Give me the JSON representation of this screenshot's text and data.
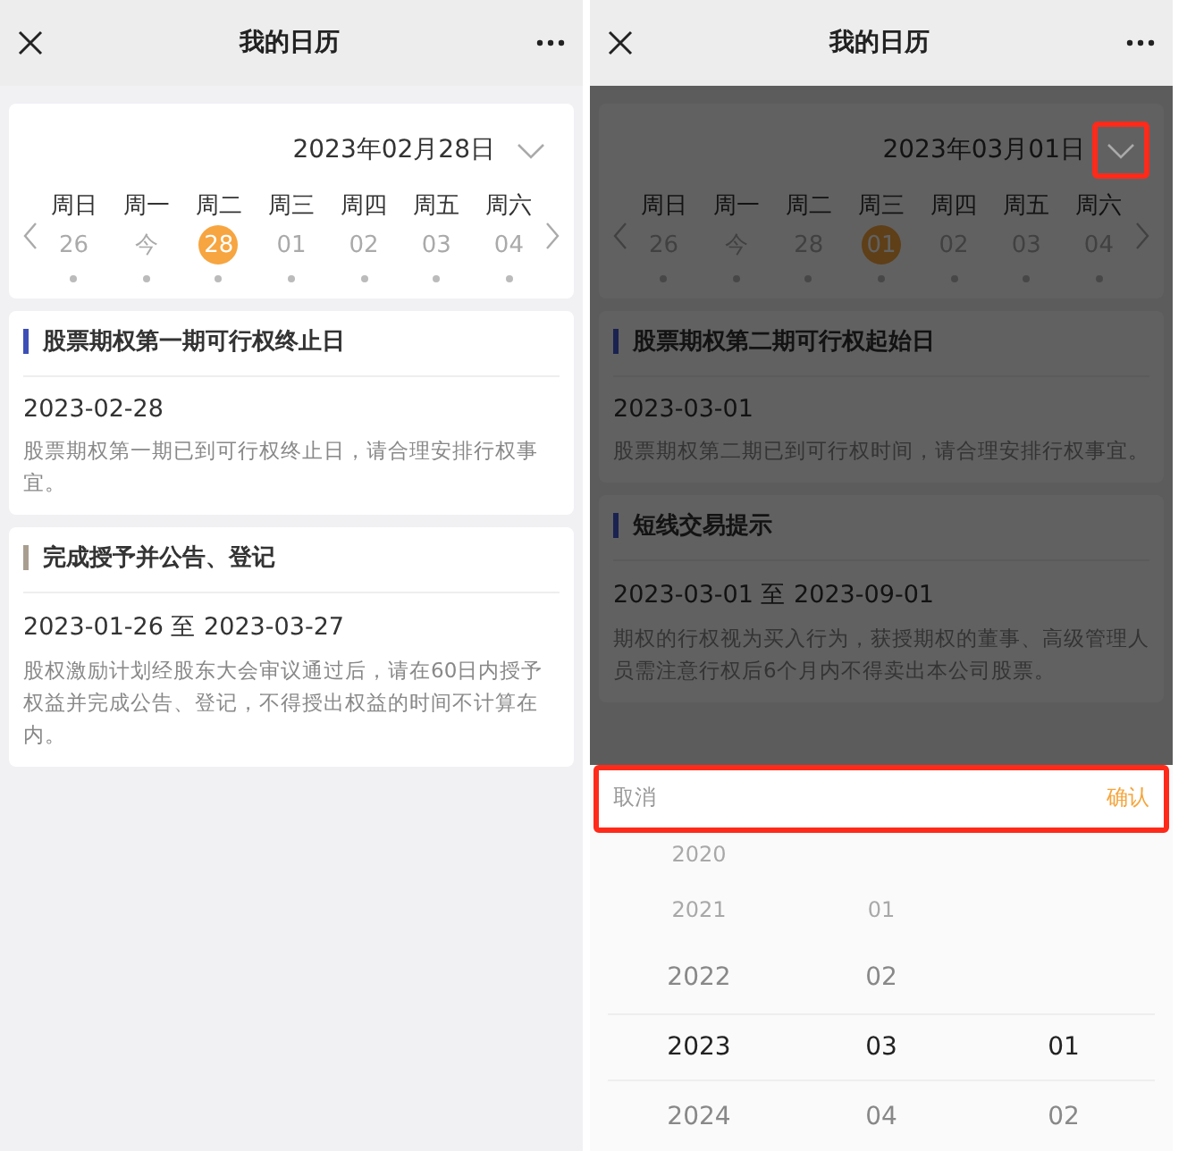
{
  "screens": [
    {
      "title": "我的日历",
      "date": "2023年02月28日",
      "date_highlighted": false,
      "dimmed": false,
      "weekdays": [
        "周日",
        "周一",
        "周二",
        "周三",
        "周四",
        "周五",
        "周六"
      ],
      "days": [
        {
          "label": "26",
          "selected": false
        },
        {
          "label": "今",
          "selected": false
        },
        {
          "label": "28",
          "selected": true
        },
        {
          "label": "01",
          "selected": false
        },
        {
          "label": "02",
          "selected": false
        },
        {
          "label": "03",
          "selected": false
        },
        {
          "label": "04",
          "selected": false
        }
      ],
      "events": [
        {
          "title": "股票期权第一期可行权终止日",
          "color": "#3d4fb5",
          "dates": "2023-02-28",
          "desc": "股票期权第一期已到可行权终止日，请合理安排行权事宜。"
        },
        {
          "title": "完成授予并公告、登记",
          "color": "#a89e90",
          "dates": "2023-01-26 至 2023-03-27",
          "desc": "股权激励计划经股东大会审议通过后，请在60日内授予权益并完成公告、登记，不得授出权益的时间不计算在内。"
        }
      ]
    },
    {
      "title": "我的日历",
      "date": "2023年03月01日",
      "date_highlighted": true,
      "dimmed": true,
      "weekdays": [
        "周日",
        "周一",
        "周二",
        "周三",
        "周四",
        "周五",
        "周六"
      ],
      "days": [
        {
          "label": "26",
          "selected": false
        },
        {
          "label": "今",
          "selected": false
        },
        {
          "label": "28",
          "selected": false
        },
        {
          "label": "01",
          "selected": true
        },
        {
          "label": "02",
          "selected": false
        },
        {
          "label": "03",
          "selected": false
        },
        {
          "label": "04",
          "selected": false
        }
      ],
      "events": [
        {
          "title": "股票期权第二期可行权起始日",
          "color": "#1a2250",
          "dates": "2023-03-01",
          "desc": "股票期权第二期已到可行权时间，请合理安排行权事宜。"
        },
        {
          "title": "短线交易提示",
          "color": "#1a2250",
          "dates": "2023-03-01 至 2023-09-01",
          "desc": "期权的行权视为买入行为，获授期权的董事、高级管理人员需注意行权后6个月内不得卖出本公司股票。"
        }
      ],
      "picker": {
        "cancel": "取消",
        "confirm": "确认",
        "header_highlighted": true,
        "rows": [
          {
            "year": "2020",
            "selected": false
          },
          {
            "year": "2021",
            "month": "01",
            "selected": false
          },
          {
            "year": "2022",
            "month": "02",
            "selected": false
          },
          {
            "year": "2023",
            "month": "03",
            "day": "01",
            "selected": true
          },
          {
            "year": "2024",
            "month": "04",
            "day": "02",
            "selected": false
          }
        ]
      }
    }
  ]
}
